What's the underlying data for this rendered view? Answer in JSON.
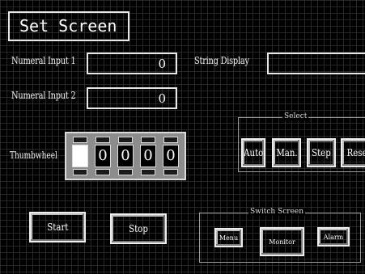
{
  "title": "Set Screen",
  "numeric_input_1": {
    "label": "Numeral Input 1",
    "value": "0"
  },
  "numeric_input_2": {
    "label": "Numeral Input 2",
    "value": "0"
  },
  "string_display": {
    "label": "String Display",
    "value": ""
  },
  "select_group": {
    "title": "Select",
    "buttons": [
      "Auto",
      "Man.",
      "Step",
      "Reset"
    ]
  },
  "thumbwheel": {
    "label": "Thumbwheel",
    "digits": [
      "",
      "0",
      "0",
      "0",
      "0"
    ]
  },
  "start_button": "Start",
  "stop_button": "Stop",
  "switch_group": {
    "title": "Switch Screen",
    "buttons": [
      "Menu",
      "Monitor",
      "Alarm"
    ]
  }
}
